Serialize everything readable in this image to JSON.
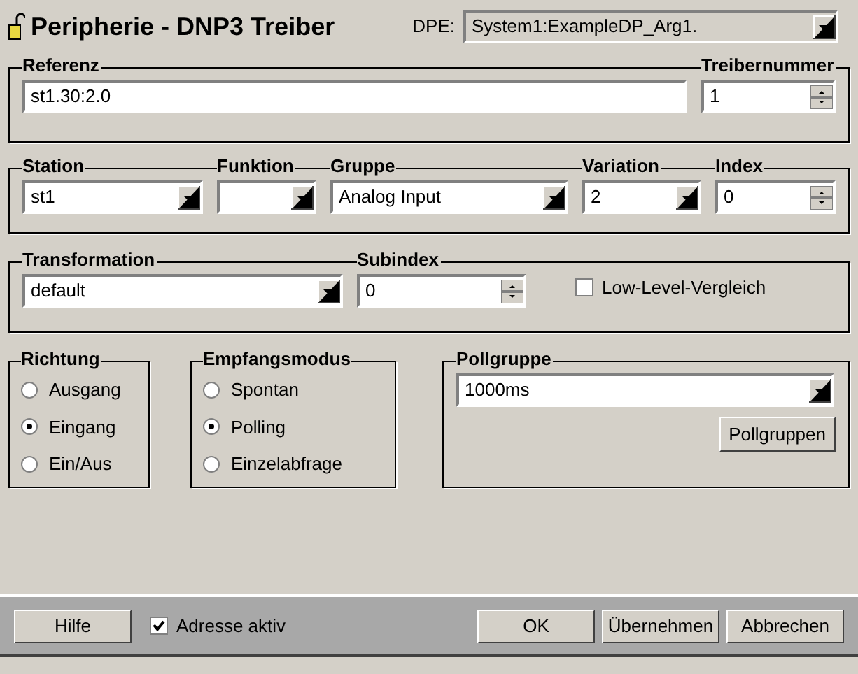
{
  "window": {
    "title": "Peripherie - DNP3 Treiber"
  },
  "dpe": {
    "label": "DPE:",
    "value": "System1:ExampleDP_Arg1."
  },
  "address_group": {
    "fields": [
      {
        "kind": "text",
        "title": "Referenz",
        "value": "st1.30:2.0"
      },
      {
        "kind": "spin",
        "title": "Treibernummer",
        "value": "1"
      }
    ]
  },
  "station_group": {
    "fields": [
      {
        "kind": "combo",
        "title": "Station",
        "value": "st1"
      },
      {
        "kind": "combo",
        "title": "Funktion"
      },
      {
        "kind": "combo",
        "title": "Gruppe",
        "value": "Analog Input"
      },
      {
        "kind": "combo",
        "title": "Variation",
        "value": "2"
      },
      {
        "kind": "spin",
        "title": "Index",
        "value": "0"
      }
    ]
  },
  "transformation_group": {
    "fields": [
      {
        "kind": "combo",
        "title": "Transformation",
        "value": "default"
      },
      {
        "kind": "spin",
        "title": "Subindex",
        "value": "0"
      },
      {
        "kind": "check",
        "label": "Low-Level-Vergleich",
        "checked": false
      }
    ]
  },
  "richtung": {
    "title": "Richtung",
    "options": [
      {
        "label": "Ausgang",
        "selected": false
      },
      {
        "label": "Eingang",
        "selected": true
      },
      {
        "label": "Ein/Aus",
        "selected": false
      }
    ]
  },
  "empfangsmodus": {
    "title": "Empfangsmodus",
    "options": [
      {
        "label": "Spontan",
        "selected": false
      },
      {
        "label": "Polling",
        "selected": true
      },
      {
        "label": "Einzelabfrage",
        "selected": false
      }
    ]
  },
  "pollgruppe": {
    "title": "Pollgruppe",
    "value": "1000ms",
    "button": "Pollgruppen"
  },
  "footer": {
    "help": "Hilfe",
    "address_active": {
      "label": "Adresse aktiv",
      "checked": true
    },
    "buttons": [
      "OK",
      "Übernehmen",
      "Abbrechen"
    ]
  }
}
